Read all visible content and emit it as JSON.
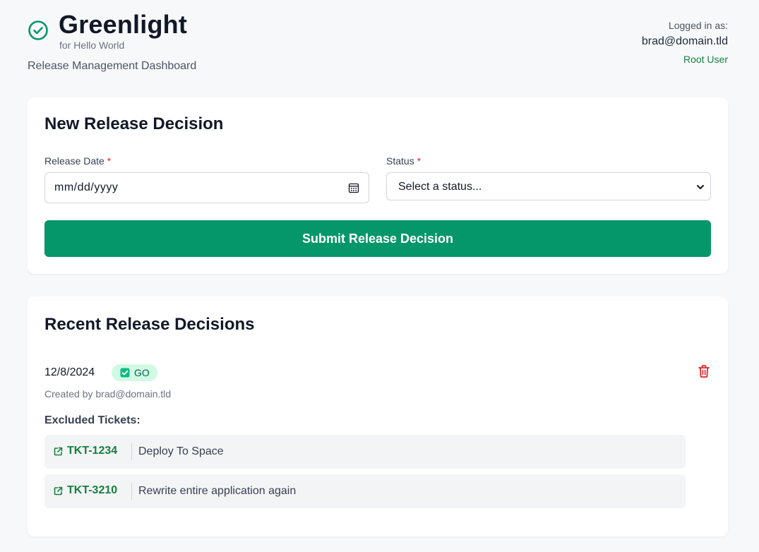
{
  "header": {
    "title": "Greenlight",
    "subtitle": "for Hello World",
    "dashboard_label": "Release Management Dashboard",
    "brand_icon": "check-circle-icon",
    "brand_color": "#059669"
  },
  "user": {
    "logged_in_label": "Logged in as:",
    "email": "brad@domain.tld",
    "role": "Root User"
  },
  "new_decision": {
    "title": "New Release Decision",
    "release_date_label": "Release Date",
    "required_marker": "*",
    "release_date_placeholder": "mm/dd/yyyy",
    "status_label": "Status",
    "status_selected": "Select a status...",
    "submit_label": "Submit Release Decision",
    "submit_color": "#059669"
  },
  "recent": {
    "title": "Recent Release Decisions",
    "decisions": [
      {
        "date": "12/8/2024",
        "status": "GO",
        "created_by": "Created by brad@domain.tld",
        "excluded_label": "Excluded Tickets:",
        "tickets": [
          {
            "id": "TKT-1234",
            "description": "Deploy To Space"
          },
          {
            "id": "TKT-3210",
            "description": "Rewrite entire application again"
          }
        ]
      }
    ]
  },
  "colors": {
    "accent": "#059669",
    "badge_bg": "#d1fae5",
    "danger": "#dc2626",
    "page_bg": "#f7f8fa"
  }
}
